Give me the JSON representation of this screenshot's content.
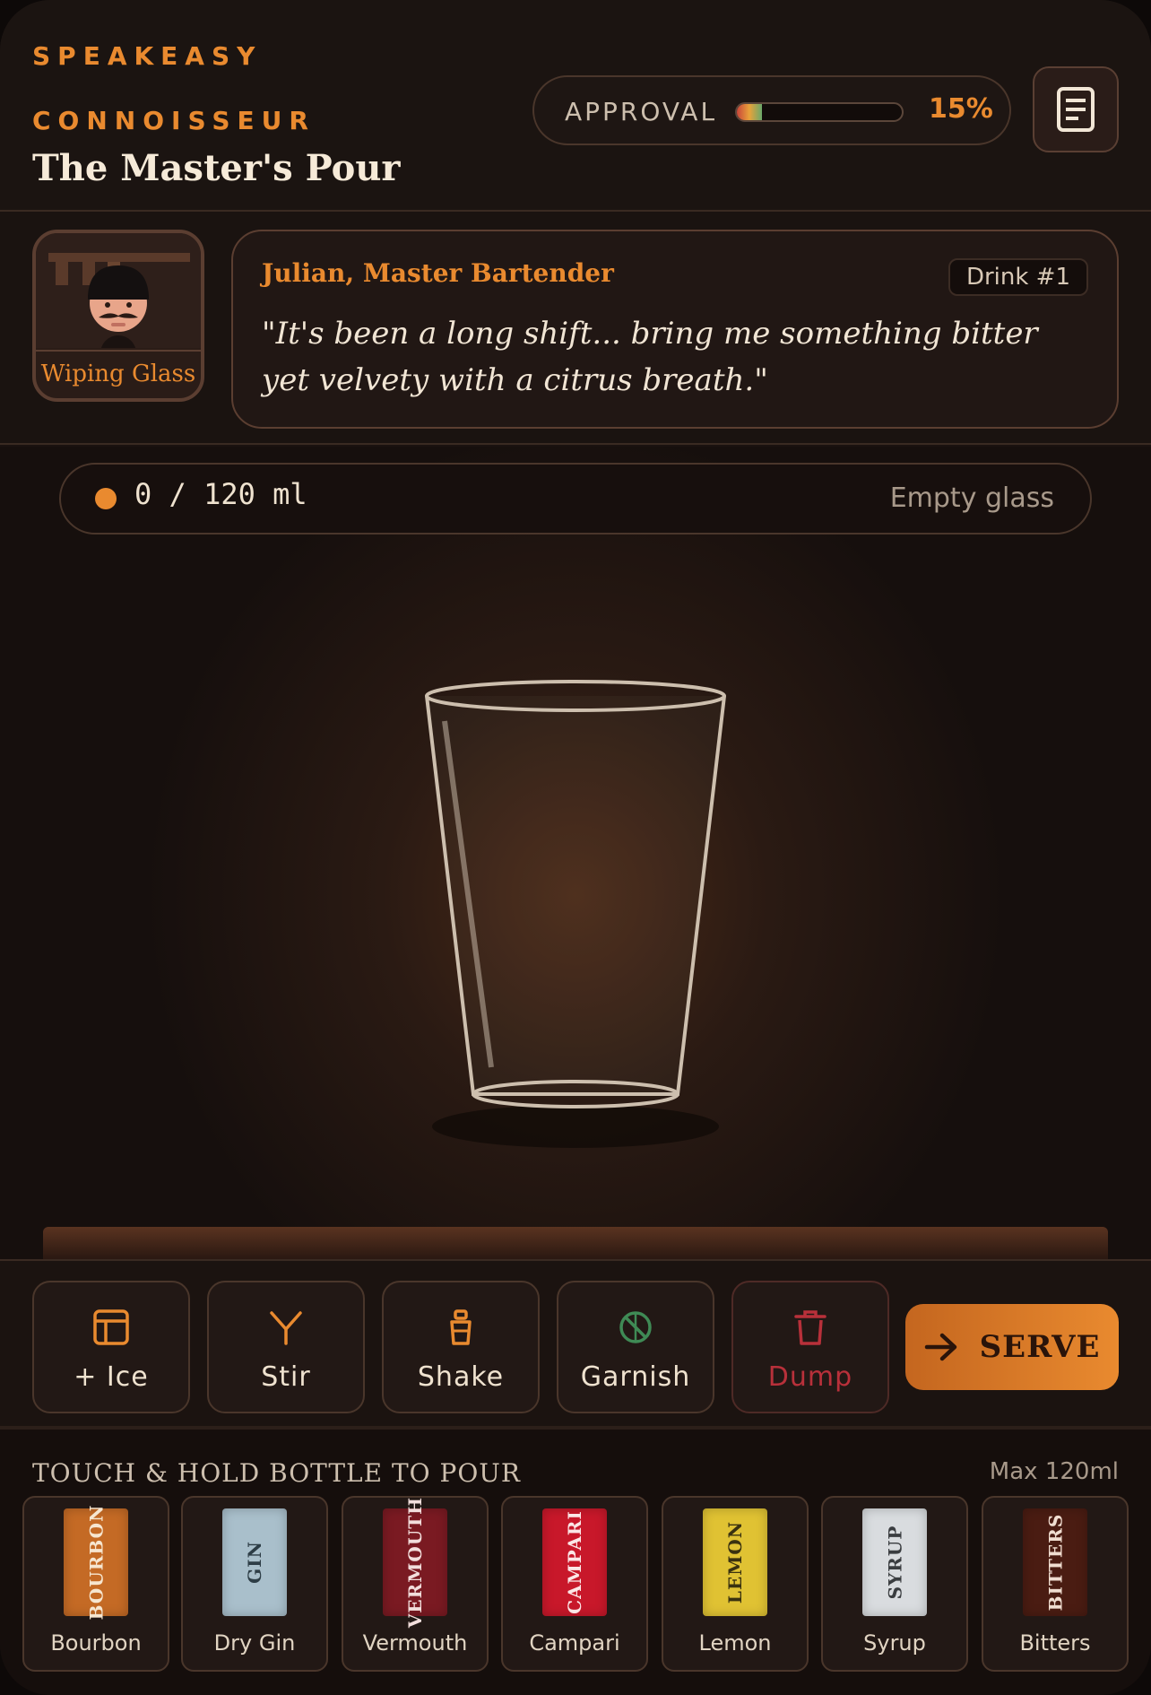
{
  "header": {
    "brand_line1": "SPEAKEASY",
    "brand_line2": "CONNOISSEUR",
    "title": "The Master's Pour",
    "approval_label": "APPROVAL",
    "approval_value": 0.15,
    "approval_text": "15%",
    "book_icon": "recipe-book-icon"
  },
  "bartender": {
    "status": "Wiping Glass",
    "name": "Julian, Master Bartender",
    "drink_number": "Drink #1",
    "quote": "\"It's been a long shift... bring me something bitter yet velvety with a citrus breath.\""
  },
  "glass": {
    "volume_text": "0 / 120 ml",
    "state_text": "Empty glass",
    "fill_fraction": 0
  },
  "actions": [
    {
      "label": "+ Ice",
      "icon": "ice-icon"
    },
    {
      "label": "Stir",
      "icon": "stir-icon"
    },
    {
      "label": "Shake",
      "icon": "shaker-icon"
    },
    {
      "label": "Garnish",
      "icon": "garnish-icon"
    },
    {
      "label": "Dump",
      "icon": "trash-icon"
    }
  ],
  "serve": {
    "label": "SERVE",
    "icon": "arrow-right-icon"
  },
  "bottles": {
    "hint": "TOUCH & HOLD BOTTLE TO POUR",
    "max": "Max 120ml",
    "items": [
      {
        "label": "BOURBON",
        "name": "Bourbon",
        "color": "#c46a25",
        "text_color": "#f6e6d0"
      },
      {
        "label": "GIN",
        "name": "Dry Gin",
        "color": "#a9bfcb",
        "text_color": "#2d3d46"
      },
      {
        "label": "VERMOUTH",
        "name": "Vermouth",
        "color": "#7a1a22",
        "text_color": "#f2dedc"
      },
      {
        "label": "CAMPARI",
        "name": "Campari",
        "color": "#c8182a",
        "text_color": "#fbe6e6"
      },
      {
        "label": "LEMON",
        "name": "Lemon",
        "color": "#e0c233",
        "text_color": "#3a3210"
      },
      {
        "label": "SYRUP",
        "name": "Syrup",
        "color": "#d9dcdf",
        "text_color": "#3a3d40"
      },
      {
        "label": "BITTERS",
        "name": "Bitters",
        "color": "#4a1c12",
        "text_color": "#f0ddd0"
      }
    ]
  }
}
